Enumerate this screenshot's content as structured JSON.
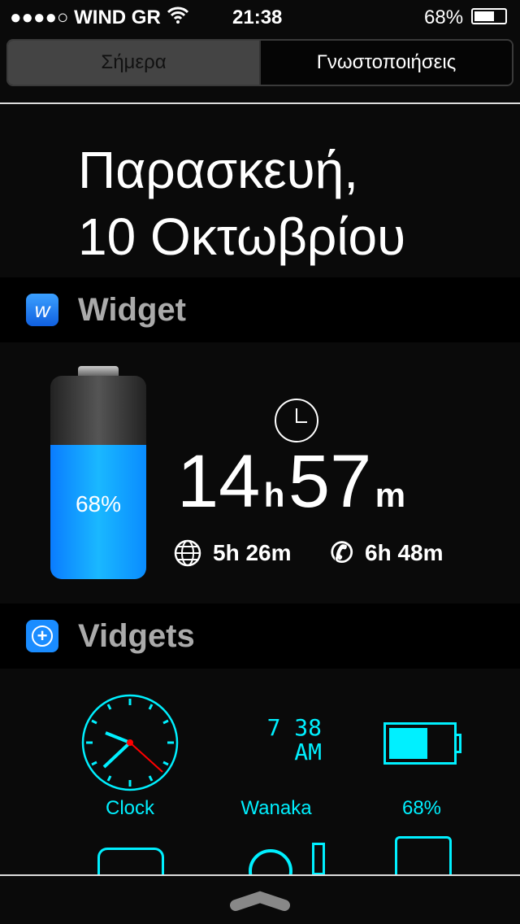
{
  "status": {
    "carrier": "●●●●○ WIND GR",
    "time": "21:38",
    "battery": "68%",
    "battery_level": 68
  },
  "segments": [
    {
      "label": "Σήμερα",
      "selected": true
    },
    {
      "label": "Γνωστοποιήσεις",
      "selected": false
    }
  ],
  "date": {
    "line1": "Παρασκευή,",
    "line2": "10 Οκτωβρίου"
  },
  "widget": {
    "title": "Widget",
    "battery_percent": "68%",
    "battery_level": 68,
    "remaining_hours": "14",
    "h": "h",
    "remaining_minutes": "57",
    "m": "m",
    "internet": "5h 26m",
    "talk": "6h 48m"
  },
  "vidgets": {
    "title": "Vidgets",
    "items": [
      {
        "label": "Clock"
      },
      {
        "label": "Wanaka",
        "time": "7 38",
        "ampm": "AM"
      },
      {
        "label": "68%"
      }
    ],
    "accent": "#00f0ff"
  }
}
